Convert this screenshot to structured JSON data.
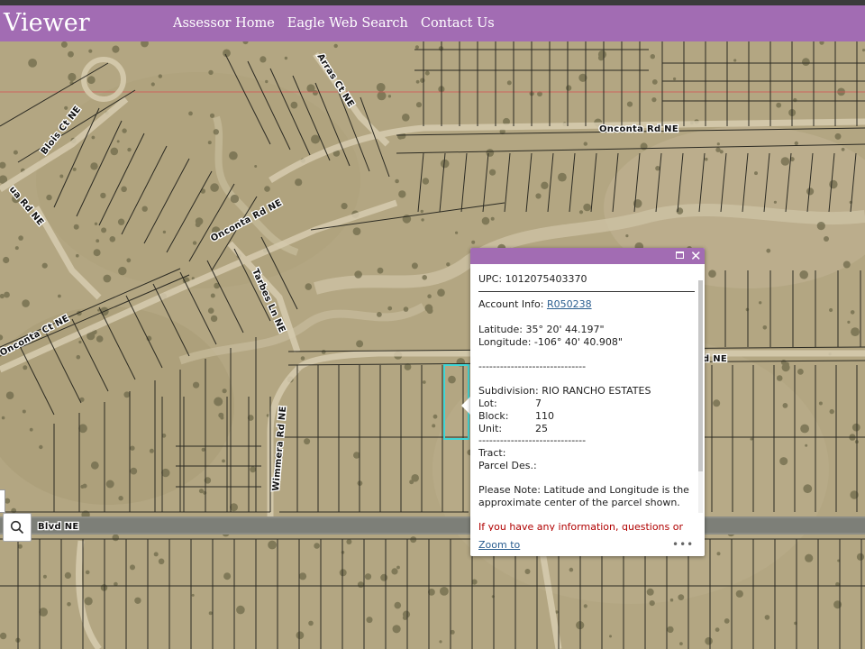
{
  "header": {
    "title": "Viewer",
    "nav": [
      "Assessor Home",
      "Eagle Web Search",
      "Contact Us"
    ]
  },
  "map": {
    "road_labels": {
      "arras": "Arras Ct NE",
      "blois": "Blois Ct NE",
      "onconta_upper": "Onconta Rd NE",
      "onconta_mid": "Onconta Rd NE",
      "ua": "ua Rd NE",
      "onconta_ct": "Onconta Ct NE",
      "tarbes": "Tarbes Ln NE",
      "wimmera": "Wimmera Rd NE",
      "blvd": "Blvd NE",
      "rd_ne": "d NE"
    },
    "icons": {
      "search": "search-icon"
    },
    "selection_color": "#3fd6d6"
  },
  "popup": {
    "upc": "UPC: 1012075403370",
    "account_label": "Account Info: ",
    "account_link": "R050238",
    "latitude": "Latitude: 35° 20' 44.197\"",
    "longitude": "Longitude: -106° 40' 40.908\"",
    "separator": "------------------------------",
    "subdivision": "Subdivision: RIO RANCHO ESTATES",
    "lot_label": "Lot:",
    "lot_value": "7",
    "block_label": "Block:",
    "block_value": "110",
    "unit_label": "Unit:",
    "unit_value": "25",
    "tract": "Tract:",
    "parcel_des": "Parcel Des.:",
    "note_line1": "Please Note: Latitude and Longitude is the",
    "note_line2": "approximate center of the parcel shown.",
    "warning_line1": "If you have any information, questions or",
    "zoom_to": "Zoom to",
    "more": "•••",
    "icons": {
      "maximize": "maximize-icon",
      "close": "close-icon"
    }
  }
}
